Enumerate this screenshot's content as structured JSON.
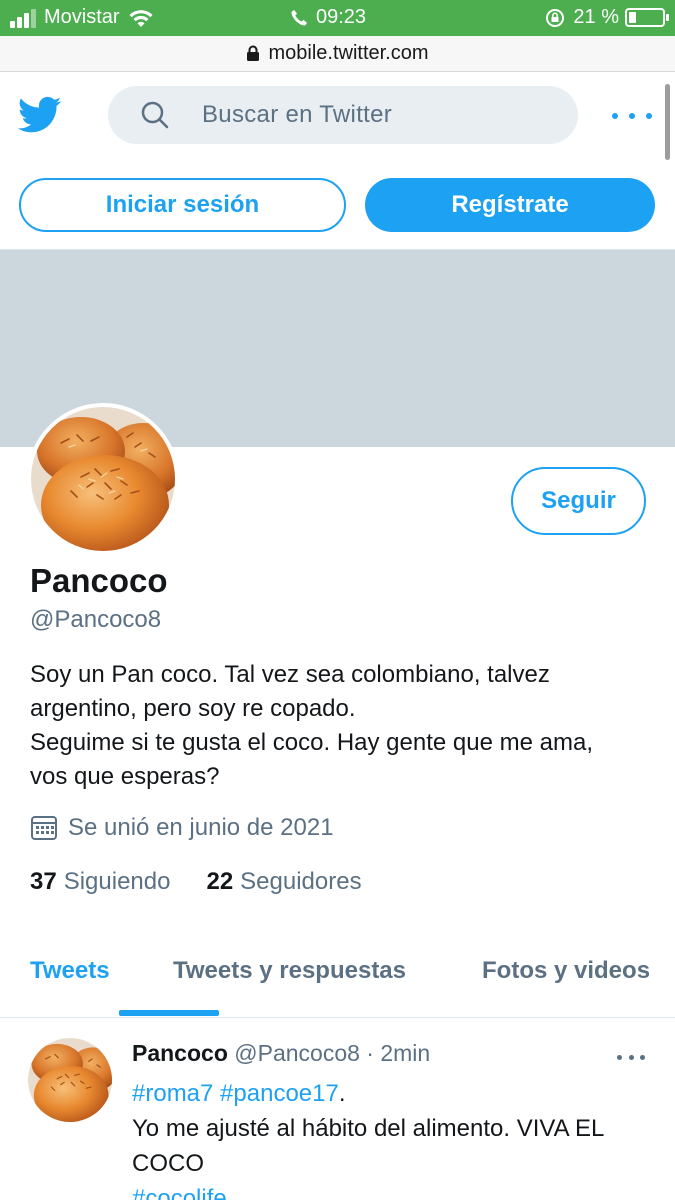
{
  "status_bar": {
    "carrier": "Movistar",
    "time": "09:23",
    "battery_percent": "21 %",
    "battery_level": 0.21,
    "icons": [
      "signal-icon",
      "wifi-icon",
      "phone-icon",
      "rotation-lock-icon",
      "battery-icon"
    ]
  },
  "url_bar": {
    "url": "mobile.twitter.com"
  },
  "header": {
    "search_placeholder": "Buscar en Twitter"
  },
  "auth": {
    "login_label": "Iniciar sesión",
    "signup_label": "Regístrate"
  },
  "profile": {
    "follow_label": "Seguir",
    "display_name": "Pancoco",
    "handle": "@Pancoco8",
    "bio_lines": [
      "Soy un Pan coco. Tal vez sea colombiano, talvez",
      "argentino, pero soy re copado.",
      "Seguime si te gusta el coco. Hay gente que me ama,",
      "vos que esperas?"
    ],
    "joined": "Se unió en junio de 2021",
    "following_count": "37",
    "following_label": "Siguiendo",
    "followers_count": "22",
    "followers_label": "Seguidores"
  },
  "tabs": [
    {
      "label": "Tweets",
      "active": true
    },
    {
      "label": "Tweets y respuestas",
      "active": false
    },
    {
      "label": "Fotos y videos",
      "active": false
    }
  ],
  "tweet": {
    "name": "Pancoco",
    "handle_time": "@Pancoco8 · 2min",
    "hashtag_1": "#roma7",
    "hashtag_2": "#pancoe17",
    "hashtag_suffix": ".",
    "text_line_1": "Yo me ajusté al hábito del alimento. VIVA EL",
    "text_line_2": "COCO",
    "hashtag_3": "#cocolife"
  },
  "colors": {
    "twitter_blue": "#1da1f2",
    "status_green": "#4cae4f",
    "banner_gray": "#ccd6dd",
    "secondary_text": "#5b7083"
  }
}
